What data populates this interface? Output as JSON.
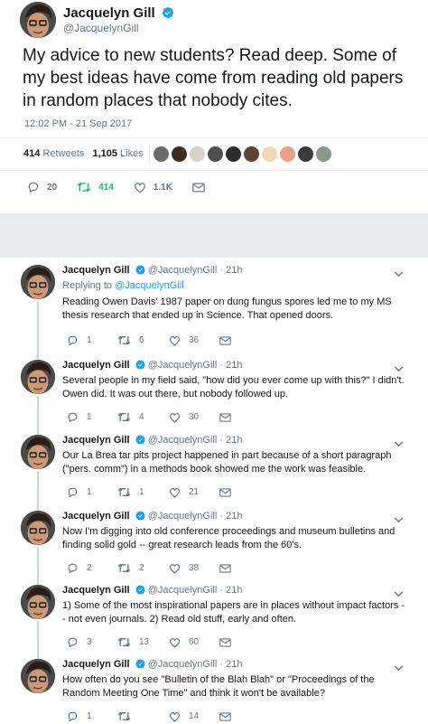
{
  "tweet": {
    "name": "Jacquelyn Gill",
    "handle": "@JacquelynGill",
    "text": "My advice to new students? Read deep. Some of my best ideas have come from reading old papers in random places that nobody cites.",
    "timestamp": "12:02 PM - 21 Sep 2017",
    "retweets_count": "414",
    "retweets_label": "Retweets",
    "likes_count": "1,105",
    "likes_label": "Likes",
    "actions": {
      "replies": "20",
      "retweets": "414",
      "likes": "1.1K"
    }
  },
  "colors": {
    "accent": "#1da1f2",
    "retweet": "#17bf63",
    "muted": "#657786"
  },
  "icons": [
    "verified-badge-icon",
    "reply-icon",
    "retweet-icon",
    "like-icon",
    "message-icon",
    "chevron-down-icon"
  ],
  "replies": [
    {
      "name": "Jacquelyn Gill",
      "handle": "@JacquelynGill",
      "time": "21h",
      "replying_prefix": "Replying to ",
      "replying_to": "@JacquelynGill",
      "text": "Reading Owen Davis' 1987 paper on dung fungus spores led me to my MS thesis research that ended up in Science. That opened doors.",
      "replies": "1",
      "retweets": "6",
      "likes": "36"
    },
    {
      "name": "Jacquelyn Gill",
      "handle": "@JacquelynGill",
      "time": "21h",
      "text": "Several people in my field said, \"how did you ever come up with this?\" I didn't. Owen did. It was out there, but nobody followed up.",
      "replies": "1",
      "retweets": "4",
      "likes": "30"
    },
    {
      "name": "Jacquelyn Gill",
      "handle": "@JacquelynGill",
      "time": "21h",
      "text": "Our La Brea tar pits project happened in part because of a short paragraph (\"pers. comm\") in a methods book showed me the work was feasible.",
      "replies": "1",
      "retweets": "1",
      "likes": "21"
    },
    {
      "name": "Jacquelyn Gill",
      "handle": "@JacquelynGill",
      "time": "21h",
      "text": "Now I'm digging into old conference proceedings and museum bulletins and finding solid gold -- great research leads from the 60's.",
      "replies": "2",
      "retweets": "2",
      "likes": "38"
    },
    {
      "name": "Jacquelyn Gill",
      "handle": "@JacquelynGill",
      "time": "21h",
      "text": "1) Some of the most inspirational papers are in places without impact factors -- not even journals. 2) Read old stuff, early and often.",
      "replies": "3",
      "retweets": "13",
      "likes": "60"
    },
    {
      "name": "Jacquelyn Gill",
      "handle": "@JacquelynGill",
      "time": "21h",
      "text": "How often do you see \"Bulletin of the Blah Blah\" or \"Proceedings of the Random Meeting One Time\" and think it won't be available?",
      "replies": "1",
      "retweets": "",
      "likes": "14"
    }
  ]
}
